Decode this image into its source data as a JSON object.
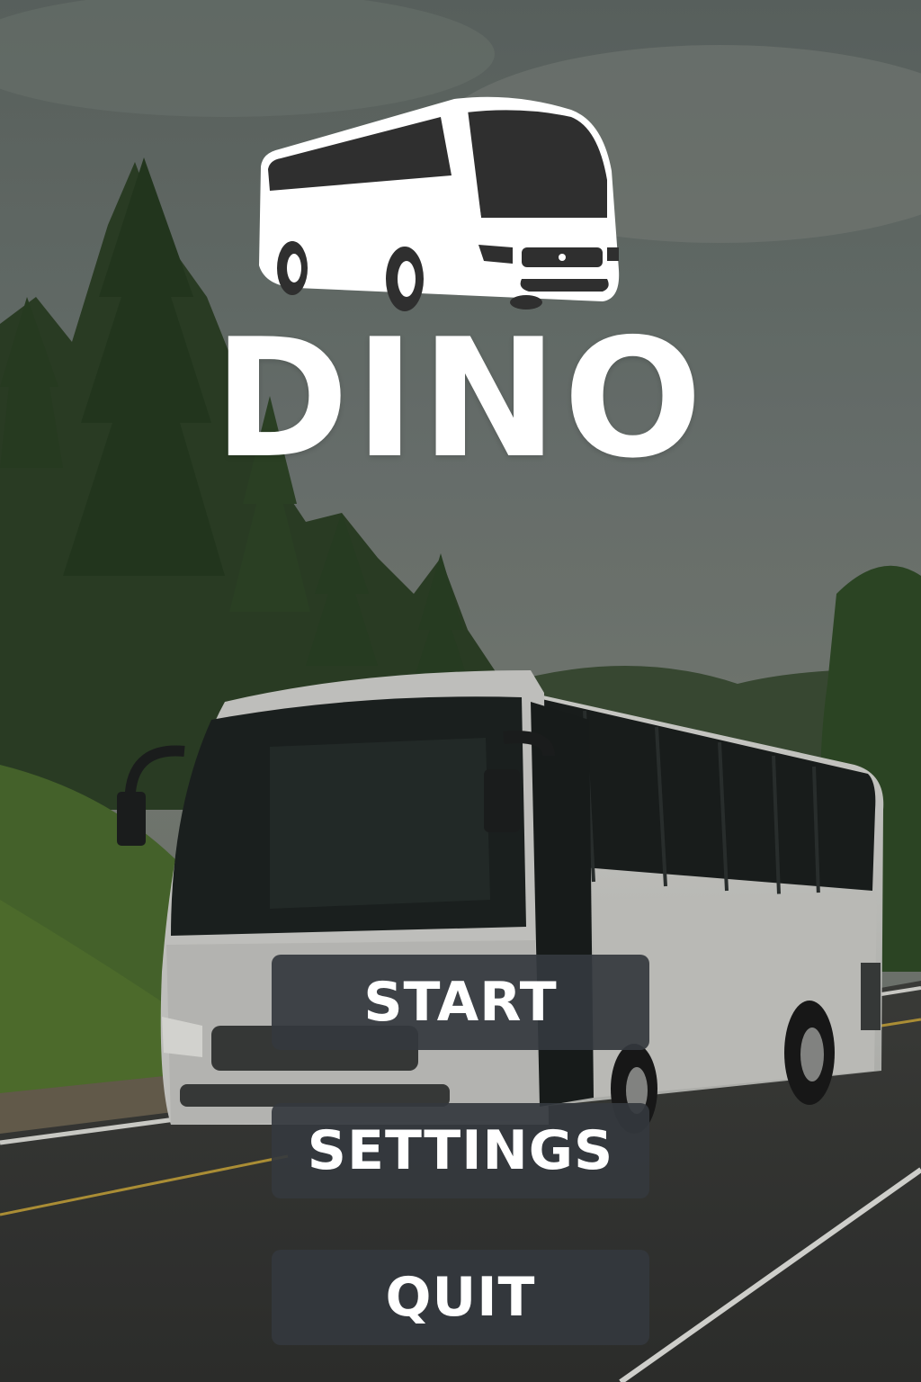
{
  "game": {
    "title": "DINO",
    "logo_icon": "coach-bus-icon"
  },
  "menu": {
    "start_label": "START",
    "settings_label": "SETTINGS",
    "quit_label": "QUIT"
  },
  "colors": {
    "title": "#ffffff",
    "button_bg": "#34383e",
    "button_text": "#ffffff"
  }
}
